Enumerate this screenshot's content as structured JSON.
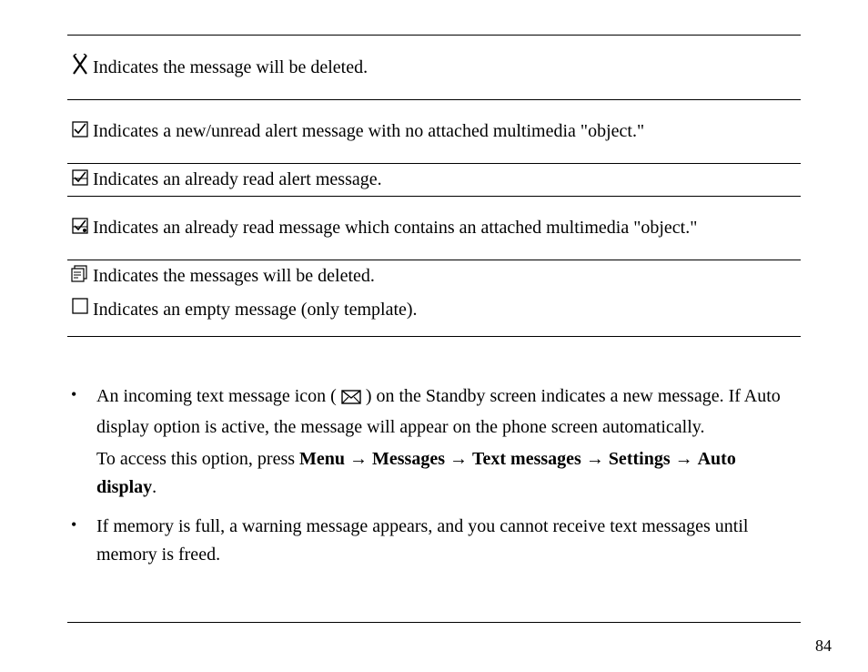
{
  "legend": {
    "rows": [
      {
        "icon": "delete-x-icon",
        "text": "Indicates the message will be deleted."
      },
      {
        "icon": "check-unread-icon",
        "text": "Indicates a new/unread alert message with no attached multimedia \"object.\""
      },
      {
        "icon": "check-read-icon",
        "text": "Indicates an already read alert message."
      },
      {
        "icon": "check-read-attach-icon",
        "text": "Indicates an already read message which contains an attached multimedia \"object.\""
      },
      {
        "icon": "multi-delete-icon",
        "text": "Indicates the messages will be deleted."
      },
      {
        "icon": "check-empty-icon",
        "text": "Indicates an empty message (only template)."
      }
    ]
  },
  "notes": {
    "items": [
      {
        "text_before": "An incoming text message icon (",
        "inline_icon": "envelope-icon",
        "text_after": ") on the Standby screen indicates a new message. If Auto display option is active, the message will appear on the phone screen automatically.",
        "continuation_line": {
          "prefix": "To access this option, press ",
          "path": [
            "Menu",
            "Messages",
            "Text messages",
            "Settings",
            "Auto display"
          ],
          "suffix": "."
        }
      },
      {
        "text_before": "If memory is full, a warning message appears, and you cannot receive text messages until memory is freed.",
        "inline_icon": null,
        "text_after": "",
        "continuation_line": null
      }
    ]
  },
  "page_number": "84"
}
